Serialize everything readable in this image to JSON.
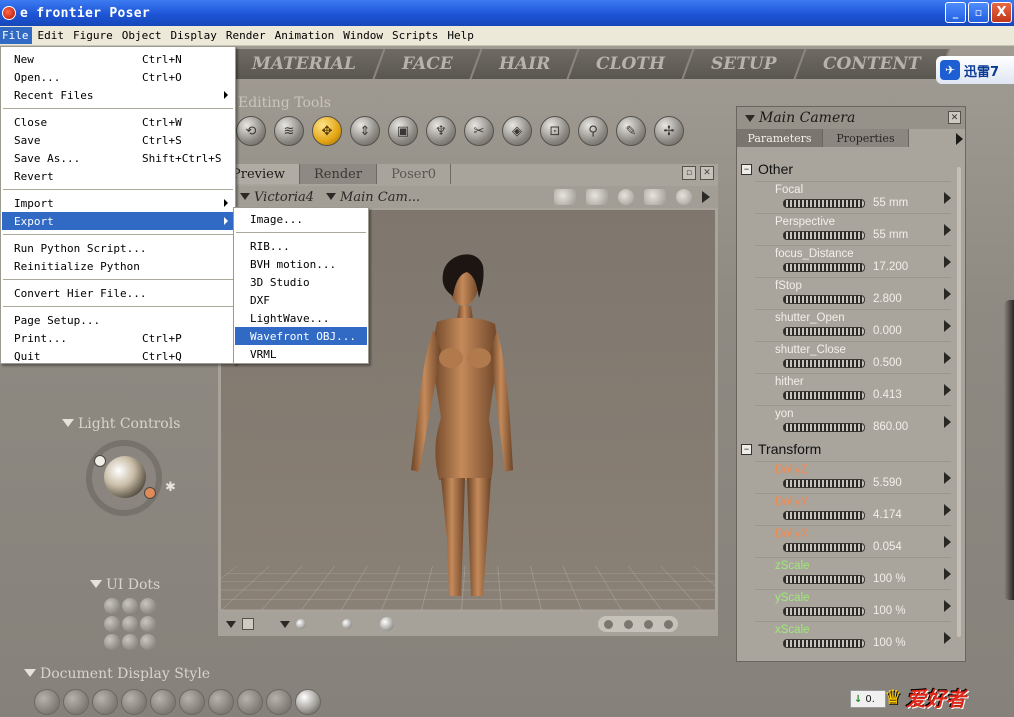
{
  "window": {
    "title": "e frontier Poser",
    "buttons": {
      "minimize": "_",
      "maximize": "▫",
      "close": "X"
    }
  },
  "menubar": [
    "File",
    "Edit",
    "Figure",
    "Object",
    "Display",
    "Render",
    "Animation",
    "Window",
    "Scripts",
    "Help"
  ],
  "rooms": [
    "MATERIAL",
    "FACE",
    "HAIR",
    "CLOTH",
    "SETUP",
    "CONTENT"
  ],
  "xunlei_badge": "迅雷7",
  "editing_tools": {
    "label": "Editing Tools",
    "tools": [
      "rotate-icon",
      "twist-icon",
      "translate-icon",
      "translate-in-out-icon",
      "scale-icon",
      "taper-icon",
      "chain-break-icon",
      "color-icon",
      "grouping-icon",
      "view-magnifier-icon",
      "morphing-tool-icon",
      "direct-manipulation-icon"
    ],
    "active_index": 2
  },
  "file_menu": {
    "items": [
      {
        "label": "New",
        "shortcut": "Ctrl+N"
      },
      {
        "label": "Open...",
        "shortcut": "Ctrl+O"
      },
      {
        "label": "Recent Files",
        "shortcut": "",
        "submenu": true
      },
      {
        "label": "Close",
        "shortcut": "Ctrl+W"
      },
      {
        "label": "Save",
        "shortcut": "Ctrl+S"
      },
      {
        "label": "Save As...",
        "shortcut": "Shift+Ctrl+S"
      },
      {
        "label": "Revert",
        "shortcut": ""
      },
      {
        "label": "Import",
        "shortcut": "",
        "submenu": true
      },
      {
        "label": "Export",
        "shortcut": "",
        "submenu": true
      },
      {
        "label": "Run Python Script...",
        "shortcut": ""
      },
      {
        "label": "Reinitialize Python",
        "shortcut": ""
      },
      {
        "label": "Convert Hier File...",
        "shortcut": ""
      },
      {
        "label": "Page Setup...",
        "shortcut": ""
      },
      {
        "label": "Print...",
        "shortcut": "Ctrl+P"
      },
      {
        "label": "Quit",
        "shortcut": "Ctrl+Q"
      }
    ],
    "highlighted": "Export"
  },
  "export_menu": {
    "items": [
      "Image...",
      "RIB...",
      "BVH motion...",
      "3D Studio",
      "DXF",
      "LightWave...",
      "Wavefront OBJ...",
      "VRML"
    ],
    "highlighted": "Wavefront OBJ..."
  },
  "preview": {
    "tabs": [
      "Preview",
      "Render",
      "Poser0"
    ],
    "active_tab": "Preview",
    "figure_select": "Victoria4",
    "camera_select": "Main Cam..."
  },
  "left_panel": {
    "light_controls": "Light Controls",
    "ui_dots": "UI Dots",
    "document_display_style": "Document Display Style"
  },
  "parameters": {
    "camera_title": "Main Camera",
    "tabs": [
      "Parameters",
      "Properties"
    ],
    "active_tab": "Parameters",
    "groups": [
      {
        "name": "Other",
        "params": [
          {
            "name": "Focal",
            "value": "55 mm"
          },
          {
            "name": "Perspective",
            "value": "55 mm"
          },
          {
            "name": "focus_Distance",
            "value": "17.200"
          },
          {
            "name": "fStop",
            "value": "2.800"
          },
          {
            "name": "shutter_Open",
            "value": "0.000"
          },
          {
            "name": "shutter_Close",
            "value": "0.500"
          },
          {
            "name": "hither",
            "value": "0.413"
          },
          {
            "name": "yon",
            "value": "860.00"
          }
        ]
      },
      {
        "name": "Transform",
        "params": [
          {
            "name": "DollyZ",
            "value": "5.590"
          },
          {
            "name": "DollyY",
            "value": "4.174"
          },
          {
            "name": "DollyX",
            "value": "0.054"
          },
          {
            "name": "zScale",
            "value": "100 %"
          },
          {
            "name": "yScale",
            "value": "100 %"
          },
          {
            "name": "xScale",
            "value": "100 %"
          }
        ]
      }
    ]
  },
  "download_badge": "0.",
  "watermark": "爱好者",
  "colors": {
    "menu_highlight": "#316ac5",
    "active_tool": "#e3a514",
    "dolly_param": "#ef8a52",
    "scale_param": "#9eea78"
  }
}
